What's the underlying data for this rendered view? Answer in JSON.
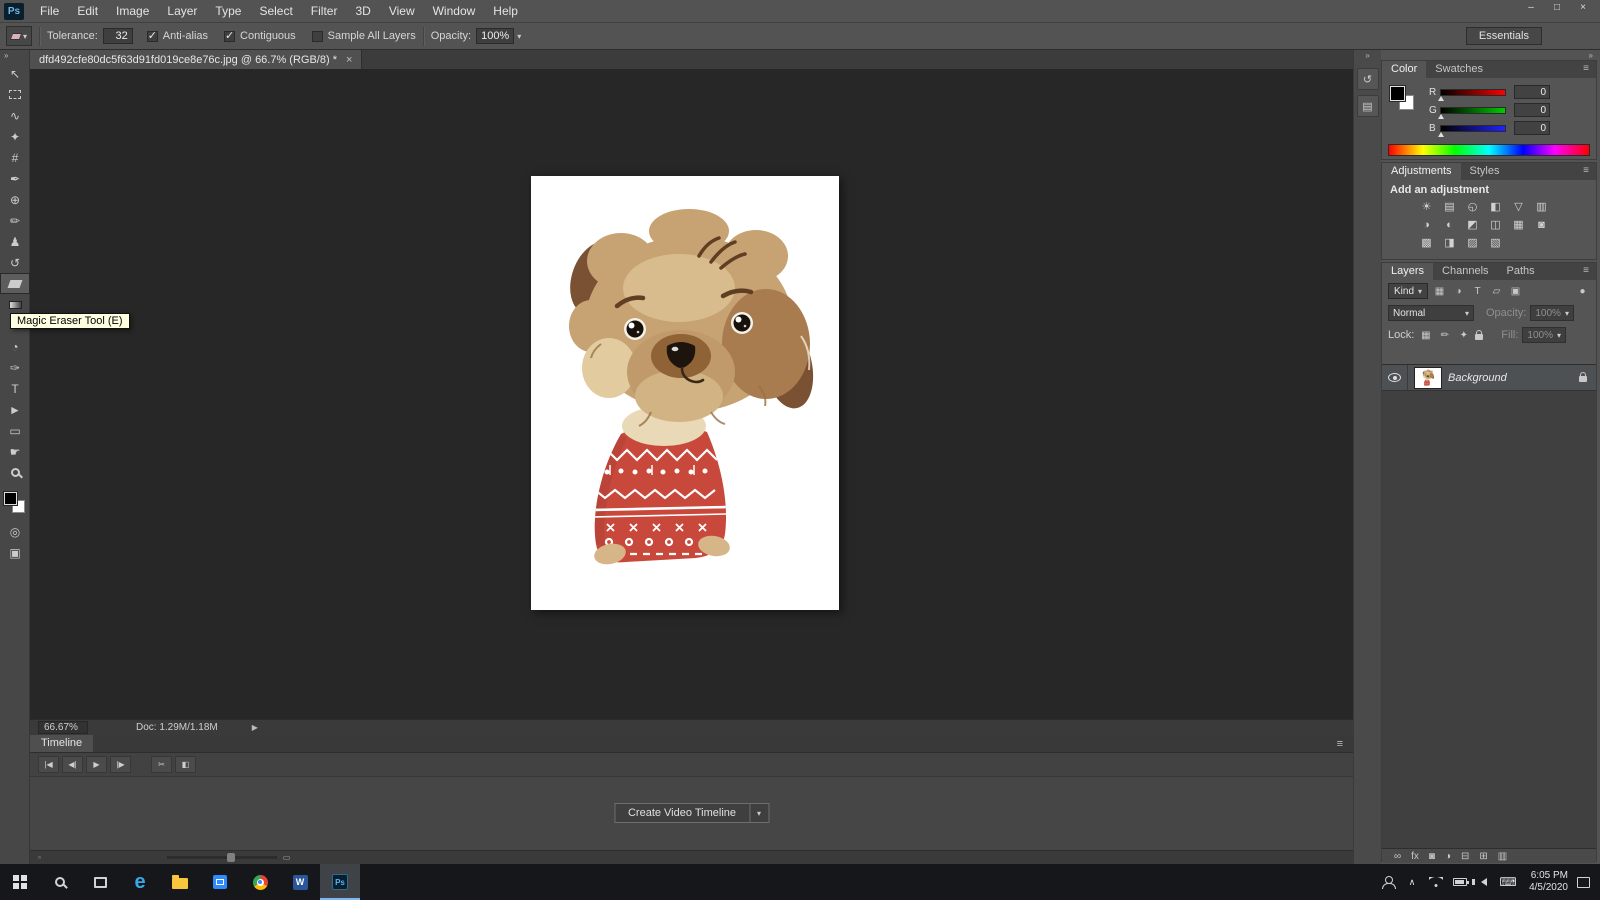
{
  "window": {
    "minimize": "–",
    "maximize": "□",
    "close": "×"
  },
  "menubar": {
    "logo": "Ps",
    "items": [
      "File",
      "Edit",
      "Image",
      "Layer",
      "Type",
      "Select",
      "Filter",
      "3D",
      "View",
      "Window",
      "Help"
    ]
  },
  "options": {
    "tolerance_label": "Tolerance:",
    "tolerance_value": "32",
    "anti_alias_label": "Anti-alias",
    "contiguous_label": "Contiguous",
    "sample_all_layers_label": "Sample All Layers",
    "opacity_label": "Opacity:",
    "opacity_value": "100%",
    "caret": "▾",
    "workspace_label": "Essentials"
  },
  "toolbar": {
    "collapse_glyph": "»",
    "tools": [
      {
        "name": "move-tool",
        "glyph": "↖"
      },
      {
        "name": "rectangular-marquee-tool",
        "glyph": ""
      },
      {
        "name": "lasso-tool",
        "glyph": "∿"
      },
      {
        "name": "quick-selection-tool",
        "glyph": "✦"
      },
      {
        "name": "crop-tool",
        "glyph": "#"
      },
      {
        "name": "eyedropper-tool",
        "glyph": "✒"
      },
      {
        "name": "spot-healing-brush-tool",
        "glyph": "⊕"
      },
      {
        "name": "brush-tool",
        "glyph": "✏"
      },
      {
        "name": "clone-stamp-tool",
        "glyph": "♟"
      },
      {
        "name": "history-brush-tool",
        "glyph": "↺"
      },
      {
        "name": "magic-eraser-tool",
        "glyph": ""
      },
      {
        "name": "gradient-tool",
        "glyph": ""
      },
      {
        "name": "blur-tool",
        "glyph": "◒"
      },
      {
        "name": "dodge-tool",
        "glyph": "◔"
      },
      {
        "name": "pen-tool",
        "glyph": "✑"
      },
      {
        "name": "type-tool",
        "glyph": "T"
      },
      {
        "name": "path-selection-tool",
        "glyph": "►"
      },
      {
        "name": "rectangle-tool",
        "glyph": "▭"
      },
      {
        "name": "hand-tool",
        "glyph": "☛"
      },
      {
        "name": "zoom-tool",
        "glyph": ""
      }
    ],
    "bottom": [
      {
        "name": "quick-mask-mode-button",
        "glyph": "◎"
      },
      {
        "name": "screen-mode-button",
        "glyph": "▣"
      }
    ]
  },
  "tooltip": "Magic Eraser Tool (E)",
  "document_tab": {
    "title": "dfd492cfe80dc5f63d91fd019ce8e76c.jpg @ 66.7% (RGB/8) *",
    "close_glyph": "×"
  },
  "status": {
    "zoom": "66.67%",
    "doc": "Doc: 1.29M/1.18M",
    "expander": "▶"
  },
  "timeline": {
    "tab": "Timeline",
    "menu_glyph": "≡",
    "controls": [
      {
        "name": "first-frame-button",
        "glyph": "|◀"
      },
      {
        "name": "previous-frame-button",
        "glyph": "◀|"
      },
      {
        "name": "play-button",
        "glyph": "▶"
      },
      {
        "name": "next-frame-button",
        "glyph": "|▶"
      },
      {
        "name": "split-clip-button",
        "glyph": "✂"
      },
      {
        "name": "transition-button",
        "glyph": "◧"
      }
    ],
    "create_button": "Create Video Timeline",
    "create_caret": "▾",
    "zoom_out_glyph": "▫",
    "zoom_in_glyph": "▭"
  },
  "panels": {
    "collapse_glyph": "»",
    "menu_glyph": "≡",
    "dock": [
      {
        "name": "history-panel-icon",
        "glyph": "↺"
      },
      {
        "name": "properties-panel-icon",
        "glyph": "▤"
      }
    ],
    "color": {
      "tabs": [
        "Color",
        "Swatches"
      ],
      "channels": [
        {
          "label": "R",
          "value": "0"
        },
        {
          "label": "G",
          "value": "0"
        },
        {
          "label": "B",
          "value": "0"
        }
      ]
    },
    "adjustments": {
      "tabs": [
        "Adjustments",
        "Styles"
      ],
      "title": "Add an adjustment",
      "icons": [
        {
          "name": "brightness-contrast-icon",
          "glyph": "☀"
        },
        {
          "name": "levels-icon",
          "glyph": "▤"
        },
        {
          "name": "curves-icon",
          "glyph": "◵"
        },
        {
          "name": "exposure-icon",
          "glyph": "◧"
        },
        {
          "name": "vibrance-icon",
          "glyph": "▽"
        },
        {
          "name": "hue-saturation-icon",
          "glyph": "▥"
        },
        {
          "name": "color-balance-icon",
          "glyph": "◑"
        },
        {
          "name": "black-white-icon",
          "glyph": "◐"
        },
        {
          "name": "photo-filter-icon",
          "glyph": "◩"
        },
        {
          "name": "channel-mixer-icon",
          "glyph": "◫"
        },
        {
          "name": "color-lookup-icon",
          "glyph": "▦"
        },
        {
          "name": "invert-icon",
          "glyph": "◙"
        },
        {
          "name": "posterize-icon",
          "glyph": "▩"
        },
        {
          "name": "threshold-icon",
          "glyph": "◨"
        },
        {
          "name": "gradient-map-icon",
          "glyph": "▨"
        },
        {
          "name": "selective-color-icon",
          "glyph": "▧"
        }
      ]
    },
    "layers": {
      "tabs": [
        "Layers",
        "Channels",
        "Paths"
      ],
      "kind_label": "Kind",
      "filter_icons": [
        {
          "name": "pixel-filter-icon",
          "glyph": "▦"
        },
        {
          "name": "adjustment-filter-icon",
          "glyph": "◑"
        },
        {
          "name": "type-filter-icon",
          "glyph": "T"
        },
        {
          "name": "shape-filter-icon",
          "glyph": "▱"
        },
        {
          "name": "smart-object-filter-icon",
          "glyph": "▣"
        }
      ],
      "filter_toggle_glyph": "●",
      "blend_mode": "Normal",
      "opacity_label": "Opacity:",
      "opacity_value": "100%",
      "lock_label": "Lock:",
      "fill_label": "Fill:",
      "fill_value": "100%",
      "lock_icons": [
        {
          "name": "lock-transparency-icon",
          "glyph": "▦"
        },
        {
          "name": "lock-image-icon",
          "glyph": "✏"
        },
        {
          "name": "lock-position-icon",
          "glyph": "✦"
        }
      ],
      "layer_name": "Background",
      "footer_icons": [
        {
          "name": "link-layers-icon",
          "glyph": "∞"
        },
        {
          "name": "layer-effects-icon",
          "glyph": "fx"
        },
        {
          "name": "add-layer-mask-icon",
          "glyph": "◙"
        },
        {
          "name": "new-adjustment-layer-icon",
          "glyph": "◑"
        },
        {
          "name": "new-group-icon",
          "glyph": "⊟"
        },
        {
          "name": "new-layer-icon",
          "glyph": "⊞"
        },
        {
          "name": "delete-layer-icon",
          "glyph": "▥"
        }
      ]
    }
  },
  "taskbar": {
    "edge_glyph": "e",
    "word_glyph": "W",
    "ps_glyph": "Ps",
    "chevron_glyph": "∧",
    "keyboard_glyph": "⌨",
    "time": "6:05 PM",
    "date": "4/5/2020"
  },
  "colors": {
    "ps_accent": "#31a8ff",
    "sweater_red": "#c8493c",
    "tooltip_bg": "#ffffe1",
    "canvas_bg": "#272727"
  }
}
